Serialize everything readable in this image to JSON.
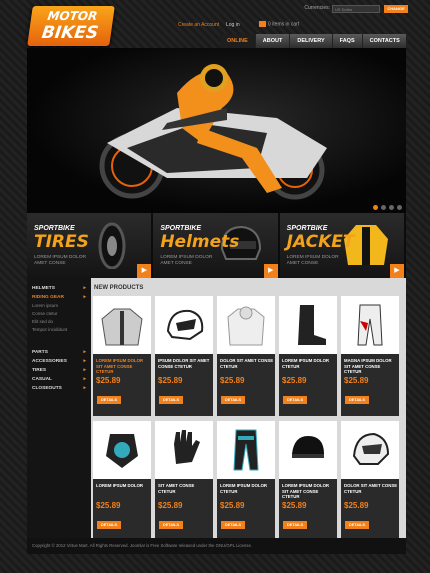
{
  "header": {
    "logo_line1": "MOTOR",
    "logo_line2": "BIKES",
    "currency_label": "Currencies:",
    "currency_value": "US Dollar",
    "change_button": "CHANGE",
    "create_account": "Create an Account",
    "login": "Log in",
    "cart_text": "0 items in cart"
  },
  "nav": {
    "items": [
      "ONLINE STORE",
      "ABOUT",
      "DELIVERY",
      "FAQS",
      "CONTACTS"
    ],
    "active": 0
  },
  "banners": [
    {
      "sub": "SPORTBIKE",
      "big": "TIRES",
      "desc": "LOREM IPSUM DOLOR AMET CONSE"
    },
    {
      "sub": "SPORTBIKE",
      "big": "Helmets",
      "desc": "LOREM IPSUM DOLOR AMET CONSE"
    },
    {
      "sub": "SPORTBIKE",
      "big": "JACKET",
      "desc": "LOREM IPSUM DOLOR AMET CONSE"
    }
  ],
  "sidebar": {
    "top": [
      {
        "label": "HELMETS",
        "orange": false
      },
      {
        "label": "RIDING GEAR",
        "orange": true
      }
    ],
    "subs": [
      "Lorem ipsum",
      "Conse ctetur",
      "Elit sed do",
      "Tempor incididunt"
    ],
    "bottom": [
      "PARTS",
      "ACCESSORIES",
      "TIRES",
      "CASUAL",
      "CLOSEOUTS"
    ]
  },
  "content": {
    "title": "NEW PRODUCTS",
    "products": [
      {
        "name": "LOREM IPSUM DOLOR SIT AMET CONSE CTETUR",
        "price": "$25.89",
        "orange": true,
        "icon": "jacket-icon"
      },
      {
        "name": "IPSUM DOLOR SIT AMET CONSE CTETUR",
        "price": "$25.89",
        "orange": false,
        "icon": "motocross-helmet-icon"
      },
      {
        "name": "DOLOR SIT AMET CONSE CTETUR",
        "price": "$25.89",
        "orange": false,
        "icon": "hoodie-icon"
      },
      {
        "name": "LOREM IPSUM DOLOR CTETUR",
        "price": "$25.89",
        "orange": false,
        "icon": "boot-icon"
      },
      {
        "name": "MAGNA IPSUM DOLOR SIT AMET CONSE CTETUR",
        "price": "$25.89",
        "orange": false,
        "icon": "riding-pants-icon"
      },
      {
        "name": "LOREM IPSUM DOLOR",
        "price": "$25.89",
        "orange": false,
        "icon": "chest-protector-icon"
      },
      {
        "name": "SIT AMET CONSE CTETUR",
        "price": "$25.89",
        "orange": false,
        "icon": "glove-icon"
      },
      {
        "name": "LOREM IPSUM DOLOR CTETUR",
        "price": "$25.89",
        "orange": false,
        "icon": "motocross-pants-icon"
      },
      {
        "name": "LOREM IPSUM DOLOR SIT AMET CONSE CTETUR",
        "price": "$25.89",
        "orange": false,
        "icon": "half-helmet-icon"
      },
      {
        "name": "DOLOR SIT AMET CONSE CTETUR",
        "price": "$25.89",
        "orange": false,
        "icon": "adventure-helmet-icon"
      }
    ],
    "details_label": "DETAILS"
  },
  "footer": {
    "text": "Copyright © 2012 Virtue Mart. All Rights Reserved. Joomla! is Free Software released under the GNU/GPL License."
  },
  "colors": {
    "accent": "#f2801b",
    "dark": "#1b1b1b"
  }
}
